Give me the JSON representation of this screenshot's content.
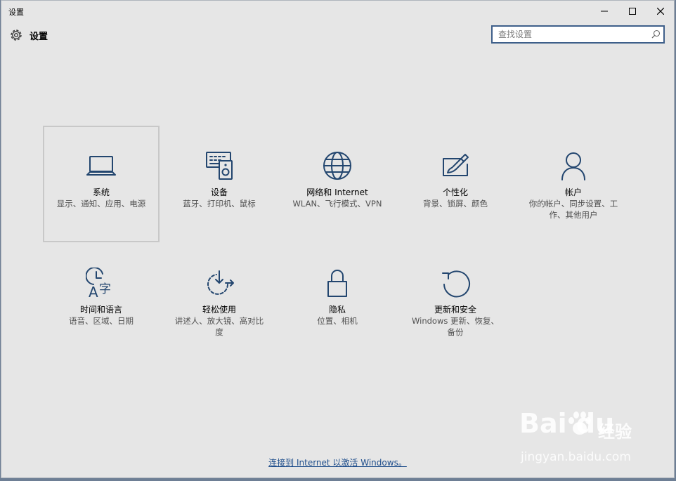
{
  "window": {
    "title": "设置",
    "controls": {
      "minimize": "minimize-icon",
      "maximize": "maximize-icon",
      "close": "close-icon"
    }
  },
  "header": {
    "title": "设置",
    "icon": "gear-icon"
  },
  "search": {
    "placeholder": "查找设置",
    "icon": "search-icon"
  },
  "tiles": [
    {
      "name": "系统",
      "desc": "显示、通知、应用、电源",
      "icon": "laptop-icon",
      "selected": true
    },
    {
      "name": "设备",
      "desc": "蓝牙、打印机、鼠标",
      "icon": "devices-icon"
    },
    {
      "name": "网络和 Internet",
      "desc": "WLAN、飞行模式、VPN",
      "icon": "globe-icon"
    },
    {
      "name": "个性化",
      "desc": "背景、锁屏、颜色",
      "icon": "personalize-icon"
    },
    {
      "name": "帐户",
      "desc": "你的帐户、同步设置、工作、其他用户",
      "icon": "person-icon"
    },
    {
      "name": "时间和语言",
      "desc": "语音、区域、日期",
      "icon": "time-language-icon"
    },
    {
      "name": "轻松使用",
      "desc": "讲述人、放大镜、高对比度",
      "icon": "ease-of-access-icon"
    },
    {
      "name": "隐私",
      "desc": "位置、相机",
      "icon": "lock-icon"
    },
    {
      "name": "更新和安全",
      "desc": "Windows 更新、恢复、备份",
      "icon": "update-icon"
    }
  ],
  "footer": {
    "activate_link": "连接到 Internet 以激活 Windows。"
  },
  "watermark": {
    "logo": "Bai du",
    "brand": "经验",
    "url": "jingyan.baidu.com"
  },
  "colors": {
    "accent": "#23466f",
    "link": "#1f4e8c",
    "search_border": "#3e5f8a",
    "background": "#e6e6e6"
  }
}
